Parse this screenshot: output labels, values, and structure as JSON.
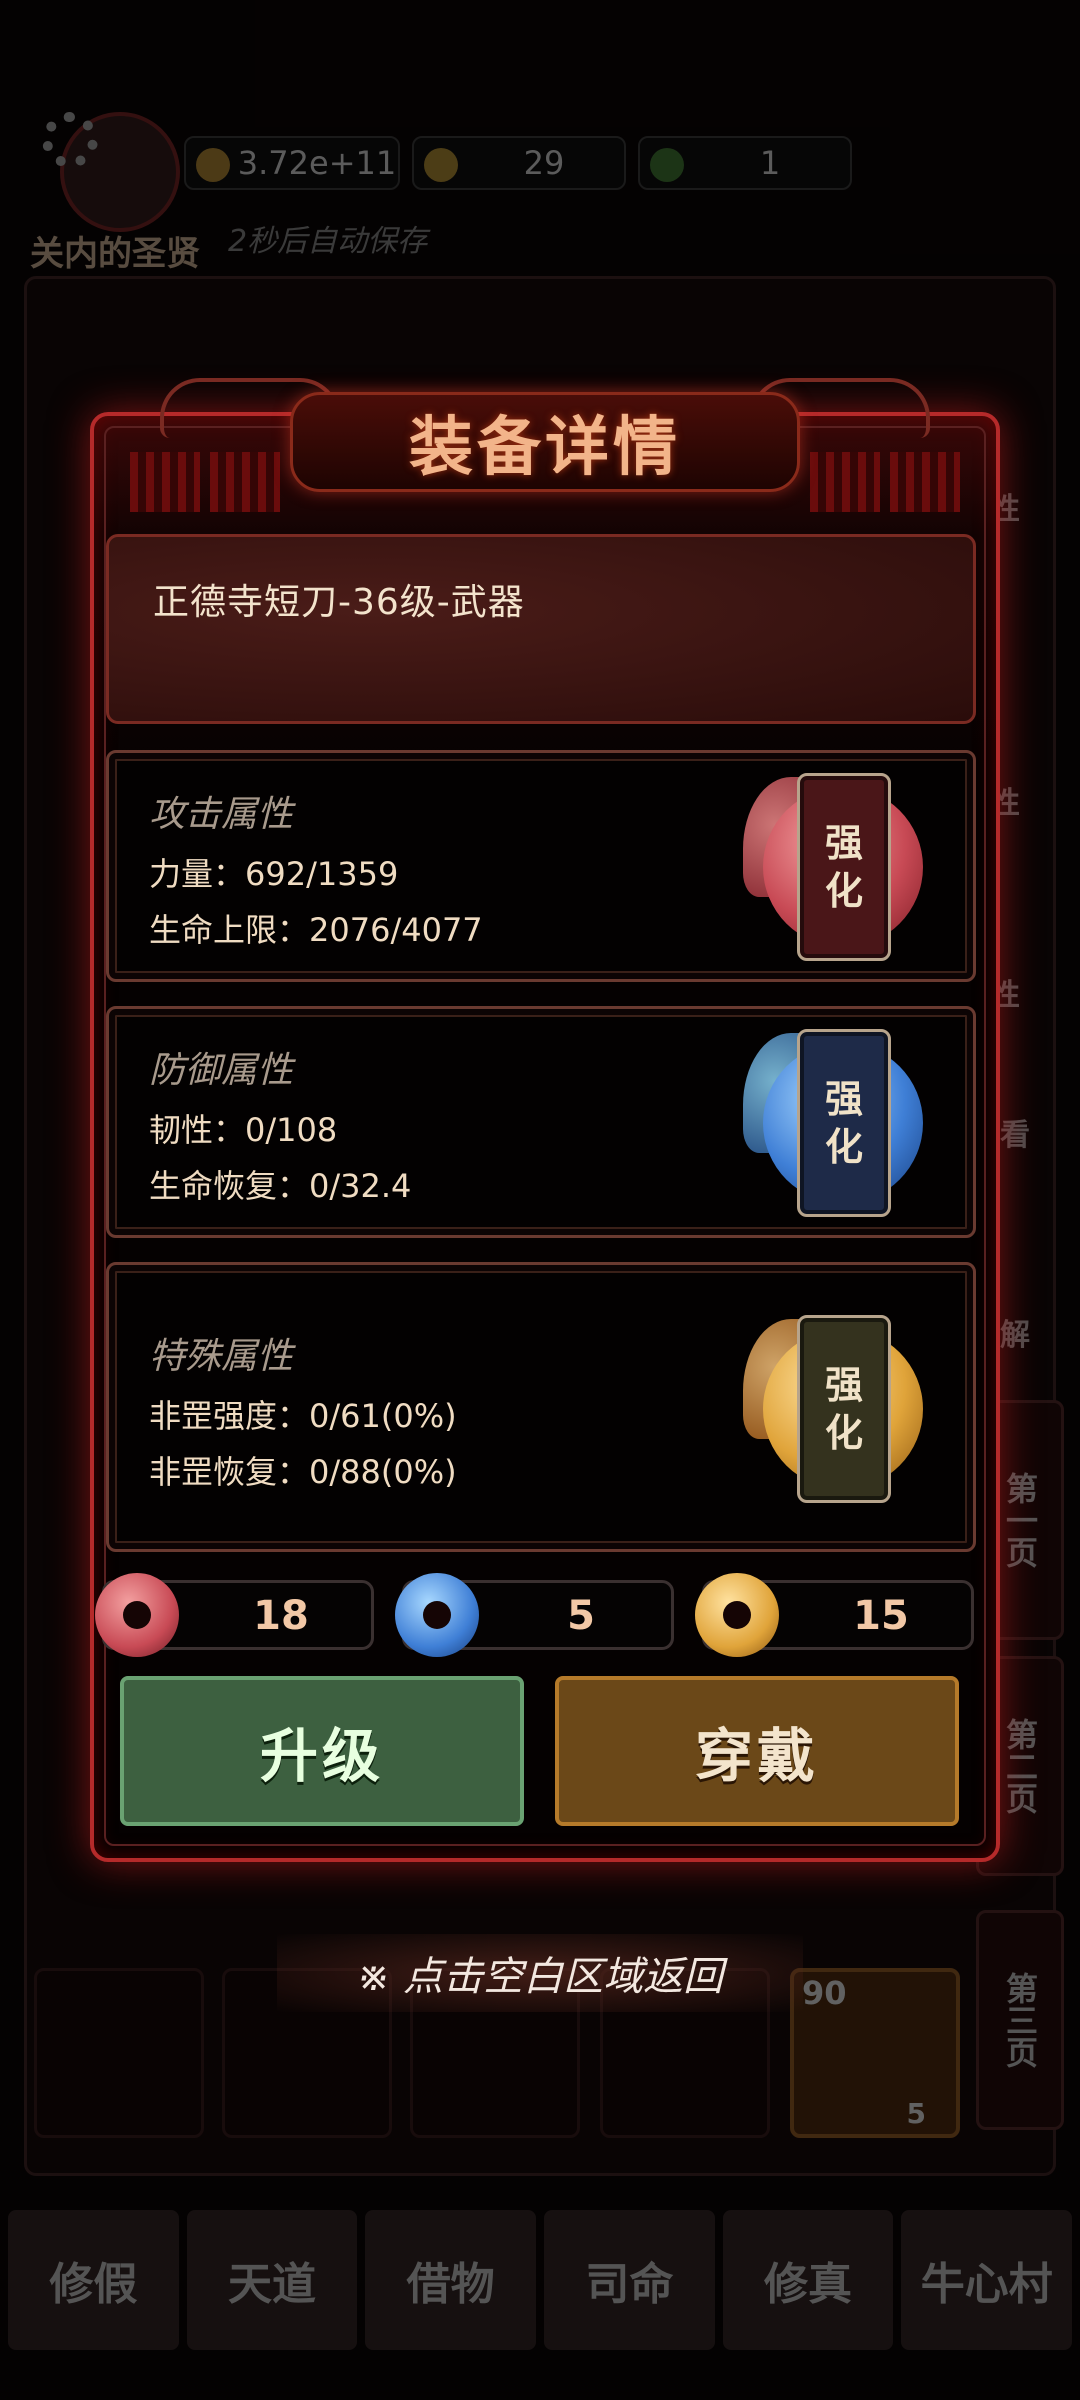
{
  "background": {
    "player_name": "关内的圣贤",
    "autosave_text": "2秒后自动保存",
    "resources": [
      {
        "icon": "coin-icon",
        "value": "3.72e+11"
      },
      {
        "icon": "lightning-icon",
        "value": "29"
      },
      {
        "icon": "gem-icon",
        "value": "1"
      }
    ],
    "side_labels": [
      "性",
      "性",
      "性",
      "看",
      "解"
    ],
    "pages": [
      "第一页",
      "第二页",
      "第三页"
    ],
    "item_level": "90",
    "item_count": "5",
    "bottom_nav": [
      "修假",
      "天道",
      "借物",
      "司命",
      "修真",
      "牛心村"
    ]
  },
  "modal": {
    "title": "装备详情",
    "item_name": "正德寺短刀-36级-武器",
    "attack": {
      "title": "攻击属性",
      "lines": [
        "力量：692/1359",
        "生命上限：2076/4077"
      ],
      "enhance": [
        "强",
        "化"
      ],
      "color": "#d9595f"
    },
    "defense": {
      "title": "防御属性",
      "lines": [
        "韧性：0/108",
        "生命恢复：0/32.4"
      ],
      "enhance": [
        "强",
        "化"
      ],
      "color": "#3f7fd6"
    },
    "special": {
      "title": "特殊属性",
      "lines": [
        "非罡强度：0/61(0%)",
        "非罡恢复：0/88(0%)"
      ],
      "enhance": [
        "强",
        "化"
      ],
      "color": "#e0a43a"
    },
    "counters": [
      "18",
      "5",
      "15"
    ],
    "upgrade_label": "升级",
    "wear_label": "穿戴"
  },
  "return_hint": "※ 点击空白区域返回"
}
